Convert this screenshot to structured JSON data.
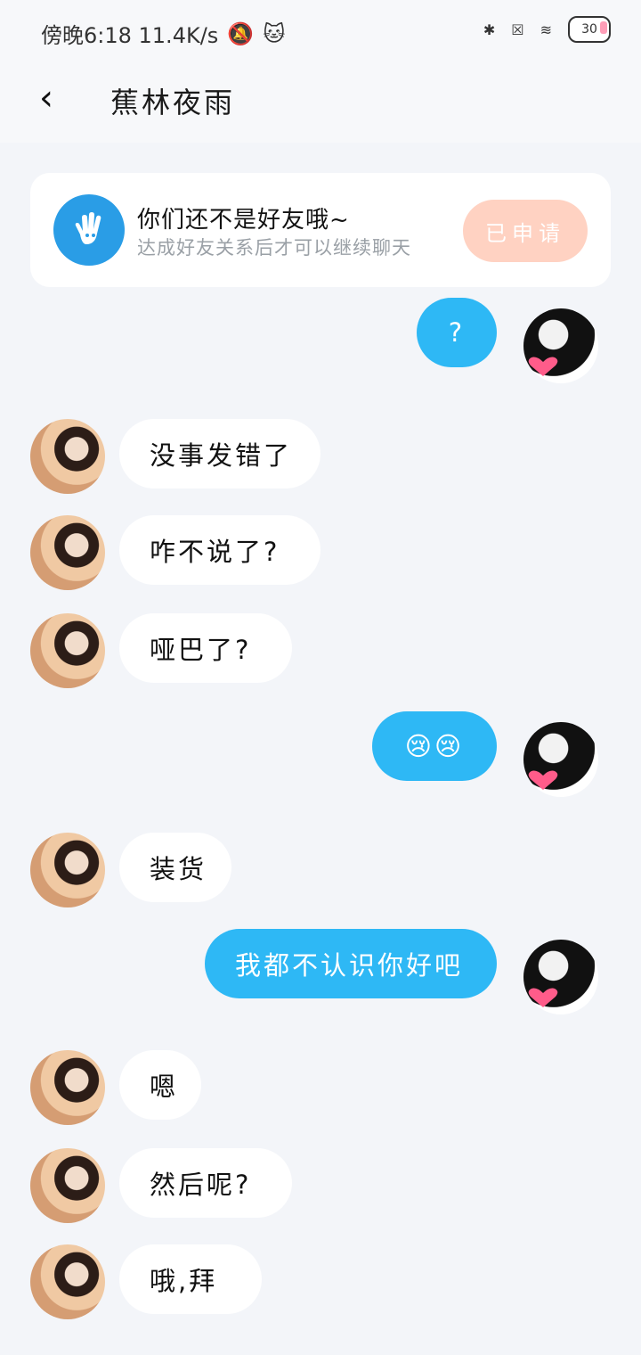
{
  "status_bar": {
    "left_text": "傍晚6:18 11.4K/s",
    "battery": "30"
  },
  "header": {
    "title": "蕉林夜雨"
  },
  "friend_card": {
    "title": "你们还不是好友哦~",
    "subtitle": "达成好友关系后才可以继续聊天",
    "button": "已申请"
  },
  "messages": [
    {
      "side": "out",
      "text": "?"
    },
    {
      "side": "in",
      "text": "没事发错了"
    },
    {
      "side": "in",
      "text": "咋不说了?"
    },
    {
      "side": "in",
      "text": "哑巴了?"
    },
    {
      "side": "out",
      "text": "😢😢"
    },
    {
      "side": "in",
      "text": "装货"
    },
    {
      "side": "out",
      "text": "我都不认识你好吧"
    },
    {
      "side": "in",
      "text": "嗯"
    },
    {
      "side": "in",
      "text": "然后呢?"
    },
    {
      "side": "in",
      "text": "哦,拜"
    }
  ],
  "colors": {
    "accent": "#2eb8f5",
    "applied_button": "#ffd2c2"
  }
}
